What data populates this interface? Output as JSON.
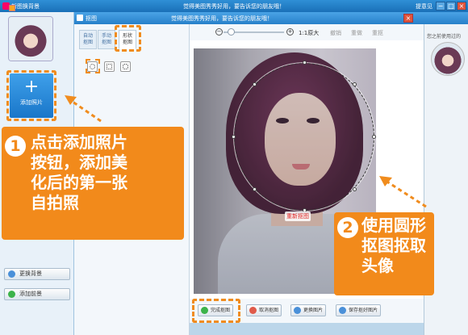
{
  "outer_window": {
    "app_title": "新图换背景",
    "center_title": "觉得美图秀秀好用，要告诉您的朋友哦！",
    "feedback": "提意见",
    "buttons": [
      "−",
      "□",
      "×"
    ]
  },
  "left_panel": {
    "add_photo_label": "添加照片",
    "add_photo_icon": "+",
    "change_background_label": "更换背景",
    "add_foreground_label": "添加前景"
  },
  "dialog": {
    "title": "抠图",
    "center_title": "觉得美图秀秀好用，要告诉您的朋友哦！",
    "close": "×"
  },
  "tabs": [
    {
      "label": "自动\n抠图",
      "active": false
    },
    {
      "label": "手动\n抠图",
      "active": false
    },
    {
      "label": "形状\n抠图",
      "active": true
    }
  ],
  "toolbar": {
    "zoom_out": "−",
    "zoom_in": "+",
    "actual_size": "1:1原大",
    "undo": "撤销",
    "redo": "重做",
    "reset": "重抠"
  },
  "canvas": {
    "recrop_label": "重新抠图"
  },
  "bottom_bar": {
    "done_label": "完成抠图",
    "cancel_label": "取消抠图",
    "change_image_label": "更换图片",
    "save_label": "保存抠好图片"
  },
  "right_panel": {
    "title": "您之前使用过的"
  },
  "callouts": {
    "step1_number": "1",
    "step1_text": [
      "点击添加照片",
      "按钮，添加美",
      "化后的第一张",
      "自拍照"
    ],
    "step2_number": "2",
    "step2_text": [
      "使用圆形",
      "抠图抠取",
      "头像"
    ]
  },
  "colors": {
    "accent_orange": "#f28a1b",
    "title_blue": "#2780c9",
    "panel_bg": "#e8f1f9"
  }
}
